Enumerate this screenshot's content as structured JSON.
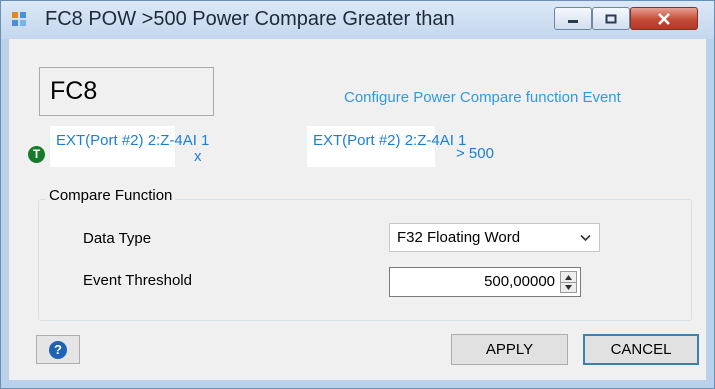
{
  "window": {
    "title": "FC8 POW >500 Power Compare Greater than"
  },
  "header": {
    "function_code": "FC8",
    "config_link": "Configure Power Compare function Event"
  },
  "expression": {
    "badge": "T",
    "operand1": "EXT(Port #2) 2:Z-4AI 1",
    "operator": "x",
    "operand2": "EXT(Port #2) 2:Z-4AI 1",
    "comparison": "> 500"
  },
  "compare_function": {
    "group_title": "Compare Function",
    "data_type_label": "Data Type",
    "data_type_value": "F32 Floating Word",
    "threshold_label": "Event Threshold",
    "threshold_value": "500,00000"
  },
  "footer": {
    "help_icon": "question-icon",
    "apply_label": "APPLY",
    "cancel_label": "CANCEL"
  },
  "colors": {
    "accent_link": "#3399dd",
    "badge_green": "#157a2a",
    "help_blue": "#1f63b5"
  }
}
